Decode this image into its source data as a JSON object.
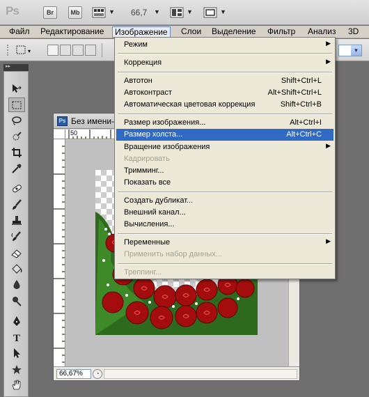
{
  "app_bar": {
    "logo": "Ps",
    "bridge_button": "Br",
    "minibridge_button": "Mb",
    "zoom": "66,7",
    "icons": [
      "film-icon",
      "arrange-documents-icon",
      "screen-mode-icon"
    ]
  },
  "menu_bar": {
    "items": [
      "Файл",
      "Редактирование",
      "Изображение",
      "Слои",
      "Выделение",
      "Фильтр",
      "Анализ",
      "3D"
    ],
    "active": "Изображение"
  },
  "dropdown": {
    "items": [
      {
        "label": "Режим",
        "shortcut": "",
        "submenu": true,
        "enabled": true
      },
      {
        "label": "Коррекция",
        "shortcut": "",
        "submenu": true,
        "enabled": true
      },
      {
        "label": "Автотон",
        "shortcut": "Shift+Ctrl+L",
        "submenu": false,
        "enabled": true
      },
      {
        "label": "Автоконтраст",
        "shortcut": "Alt+Shift+Ctrl+L",
        "submenu": false,
        "enabled": true
      },
      {
        "label": "Автоматическая цветовая коррекция",
        "shortcut": "Shift+Ctrl+B",
        "submenu": false,
        "enabled": true
      },
      {
        "label": "Размер изображения...",
        "shortcut": "Alt+Ctrl+I",
        "submenu": false,
        "enabled": true
      },
      {
        "label": "Размер холста...",
        "shortcut": "Alt+Ctrl+C",
        "submenu": false,
        "enabled": true,
        "highlighted": true
      },
      {
        "label": "Вращение изображения",
        "shortcut": "",
        "submenu": true,
        "enabled": true
      },
      {
        "label": "Кадрировать",
        "shortcut": "",
        "submenu": false,
        "enabled": false
      },
      {
        "label": "Тримминг...",
        "shortcut": "",
        "submenu": false,
        "enabled": true
      },
      {
        "label": "Показать все",
        "shortcut": "",
        "submenu": false,
        "enabled": true
      },
      {
        "label": "Создать дубликат...",
        "shortcut": "",
        "submenu": false,
        "enabled": true
      },
      {
        "label": "Внешний канал...",
        "shortcut": "",
        "submenu": false,
        "enabled": true
      },
      {
        "label": "Вычисления...",
        "shortcut": "",
        "submenu": false,
        "enabled": true
      },
      {
        "label": "Переменные",
        "shortcut": "",
        "submenu": true,
        "enabled": true
      },
      {
        "label": "Применить набор данных...",
        "shortcut": "",
        "submenu": false,
        "enabled": false
      },
      {
        "label": "Треппинг...",
        "shortcut": "",
        "submenu": false,
        "enabled": false
      }
    ]
  },
  "document": {
    "icon": "Ps",
    "title": "Без имени-",
    "ruler_top_label": "50",
    "zoom": "66,67%"
  },
  "tools": [
    "move-tool",
    "marquee-tool",
    "lasso-tool",
    "quick-selection-tool",
    "crop-tool",
    "eyedropper-tool",
    "healing-brush-tool",
    "brush-tool",
    "clone-stamp-tool",
    "history-brush-tool",
    "eraser-tool",
    "paint-bucket-tool",
    "blur-tool",
    "dodge-tool",
    "pen-tool",
    "type-tool",
    "path-selection-tool",
    "shape-tool",
    "hand-tool"
  ],
  "colors": {
    "menu_highlight": "#316ac5",
    "menu_background": "#ece9d8",
    "workspace": "#6f6f6f"
  }
}
